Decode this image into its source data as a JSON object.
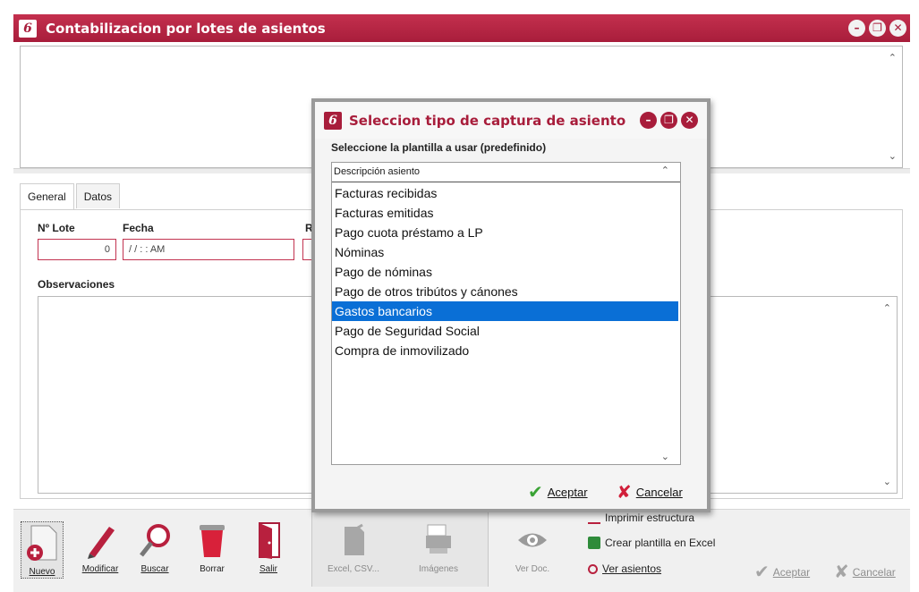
{
  "window": {
    "title": "Contabilizacion por lotes de asientos",
    "logo": "6",
    "controls": [
      "minimize-icon",
      "restore-icon",
      "close-icon"
    ]
  },
  "tabs": [
    {
      "label": "General"
    },
    {
      "label": "Datos"
    }
  ],
  "form": {
    "lote_label": "Nº Lote",
    "lote_value": "0",
    "fecha_label": "Fecha",
    "fecha_value": "/ /      :  :  AM",
    "third_label": "R",
    "observaciones_label": "Observaciones"
  },
  "toolbar": {
    "nuevo": "Nuevo",
    "modificar": "Modificar",
    "buscar": "Buscar",
    "borrar": "Borrar",
    "salir": "Salir",
    "excel": "Excel, CSV...",
    "imagenes": "Imágenes",
    "ver_doc": "Ver Doc.",
    "imprimir": "Imprimir estructura",
    "crear_plantilla": "Crear plantilla en Excel",
    "ver_asientos": "Ver asientos",
    "aceptar": "Aceptar",
    "cancelar": "Cancelar"
  },
  "dialog": {
    "title": "Seleccion tipo de captura de asiento",
    "subtitle": "Seleccione la plantilla a usar (predefinido)",
    "column_header": "Descripción asiento",
    "items": [
      "Facturas recibidas",
      "Facturas emitidas",
      "Pago cuota préstamo a LP",
      "Nóminas",
      "Pago de nóminas",
      "Pago de otros tribútos y cánones",
      "Gastos bancarios",
      "Pago de Seguridad Social",
      "Compra de inmovilizado"
    ],
    "selected_index": 6,
    "aceptar": "Aceptar",
    "cancelar": "Cancelar"
  },
  "colors": {
    "brand": "#a81d3b",
    "selection": "#0a6fd6"
  }
}
